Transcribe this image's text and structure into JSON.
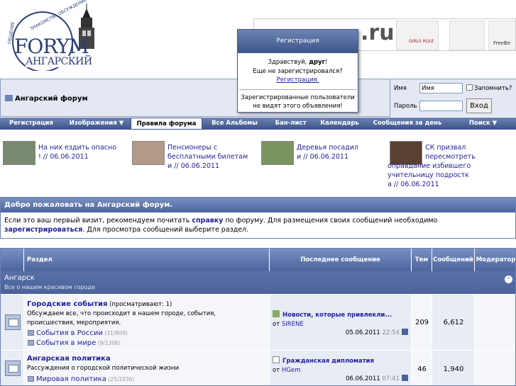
{
  "logo": {
    "top_text": "ЗНАКОМСТВА ОБСУЖДЕНИЕ",
    "side_text": "ОБЩЕНИЕ",
    "big": "FORYM",
    "bottom": "АНГАРСКИЙ"
  },
  "banner": {
    "text": ".ru",
    "girls_text": "GIRLS RULE",
    "free_text": "FreeBe"
  },
  "popup": {
    "title": "Регистрация",
    "line1_pre": "Здравствуй, ",
    "line1_bold": "друг",
    "line1_post": "!",
    "line2": "Еще не зарегистрировался?",
    "link": "Регистрация.",
    "line3": "Зарегистрированные пользователи",
    "line4": "не видят этого объявления!"
  },
  "navbar": {
    "title": "Ангарский форум"
  },
  "login": {
    "user_label": "Имя",
    "user_value": "Имя",
    "remember": "Запомнить?",
    "pass_label": "Пароль",
    "button": "Вход"
  },
  "menu": [
    "Регистрация",
    "Изображения ▼",
    "Правила форума",
    "Все Альбомы",
    "Бан-лист",
    "Календарь",
    "Сообщения за день",
    "Поиск ▼"
  ],
  "news": [
    {
      "title": "На них ездить опасно",
      "line2": "! // 06.06.2011"
    },
    {
      "title": "Пенсионеры с",
      "line2": "бесплатными билетам",
      "line3": "и // 06.06.2011"
    },
    {
      "title": "Деревья посадил",
      "line2": "и // 06.06.2011"
    },
    {
      "title": "СК призвал",
      "line2": "пересмотреть",
      "line3": "оправдание избившего",
      "line4": "учительницу подростк",
      "line5": "а // 06.06.2011"
    }
  ],
  "welcome": {
    "title": "Добро пожаловать на Ангарский форум.",
    "p1": "Если это ваш первый визит, рекомендуем почитать ",
    "link1": "справку",
    "p2": " по форуму. Для размещения своих сообщений необходимо",
    "link2": "зарегистрироваться",
    "p3": ". Для просмотра сообщений выберите раздел."
  },
  "table": {
    "headers": {
      "section": "Раздел",
      "last": "Последнее сообщение",
      "topics": "Тем",
      "posts": "Сообщений",
      "mod": "Модератор"
    },
    "category": {
      "name": "Ангарск",
      "desc": "Все о нашем красивом городе"
    },
    "forums": [
      {
        "title": "Городские события",
        "viewing": " (просматривают: 1)",
        "desc1": "Обсуждаем все, что происходит в нашем городе, события,",
        "desc2": "происшествия, мероприятия.",
        "subs": [
          {
            "name": "События в России",
            "count": " (31/809)"
          },
          {
            "name": "События в мире",
            "count": " (9/1306)"
          }
        ],
        "last_title": "Новости, которые привлекли...",
        "last_by": "от ",
        "last_user": "SIRENE",
        "last_date": "05.06.2011",
        "last_time": " 22:54",
        "topics": "209",
        "posts": "6,612"
      },
      {
        "title": "Ангарская политика",
        "desc1": "Рассуждения о городской политической жизни",
        "subs": [
          {
            "name": "Мировая политика",
            "count": " (25/1036)"
          }
        ],
        "last_title": "Гражданская дипломатия",
        "last_by": "от ",
        "last_user": "HGem",
        "last_date": "06.06.2011",
        "last_time": " 07:41",
        "topics": "46",
        "posts": "1,940"
      }
    ]
  }
}
